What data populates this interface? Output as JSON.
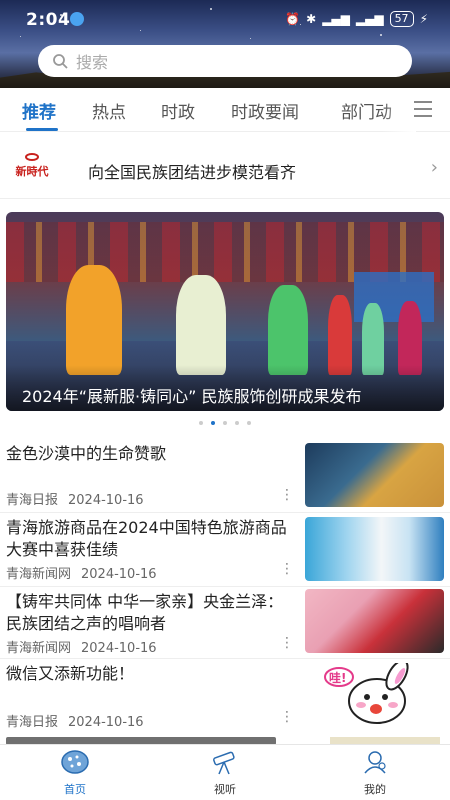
{
  "status": {
    "time": "2:04",
    "battery": "57"
  },
  "search": {
    "placeholder": "搜索"
  },
  "tabs": [
    {
      "label": "推荐",
      "active": true
    },
    {
      "label": "热点"
    },
    {
      "label": "时政"
    },
    {
      "label": "时政要闻"
    },
    {
      "label": "部门动"
    }
  ],
  "headline": {
    "logo_text": "新時代",
    "text": "向全国民族团结进步模范看齐"
  },
  "banner": {
    "caption": "2024年“展新服·铸同心” 民族服饰创研成果发布",
    "page_count": 5,
    "active_index": 1
  },
  "news": [
    {
      "title": "金色沙漠中的生命赞歌",
      "source": "青海日报",
      "date": "2024-10-16"
    },
    {
      "title": "青海旅游商品在2024中国特色旅游商品大赛中喜获佳绩",
      "source": "青海新闻网",
      "date": "2024-10-16"
    },
    {
      "title": "【铸牢共同体 中华一家亲】央金兰泽：民族团结之声的唱响者",
      "source": "青海新闻网",
      "date": "2024-10-16"
    },
    {
      "title": "微信又添新功能！",
      "source": "青海日报",
      "date": "2024-10-16",
      "sticker_text": "哇!"
    }
  ],
  "bottom_nav": [
    {
      "label": "首页",
      "icon": "home-icon",
      "active": true
    },
    {
      "label": "视听",
      "icon": "telescope-icon"
    },
    {
      "label": "我的",
      "icon": "profile-icon"
    }
  ],
  "colors": {
    "accent": "#1f73c8",
    "logo_red": "#c8211d"
  }
}
